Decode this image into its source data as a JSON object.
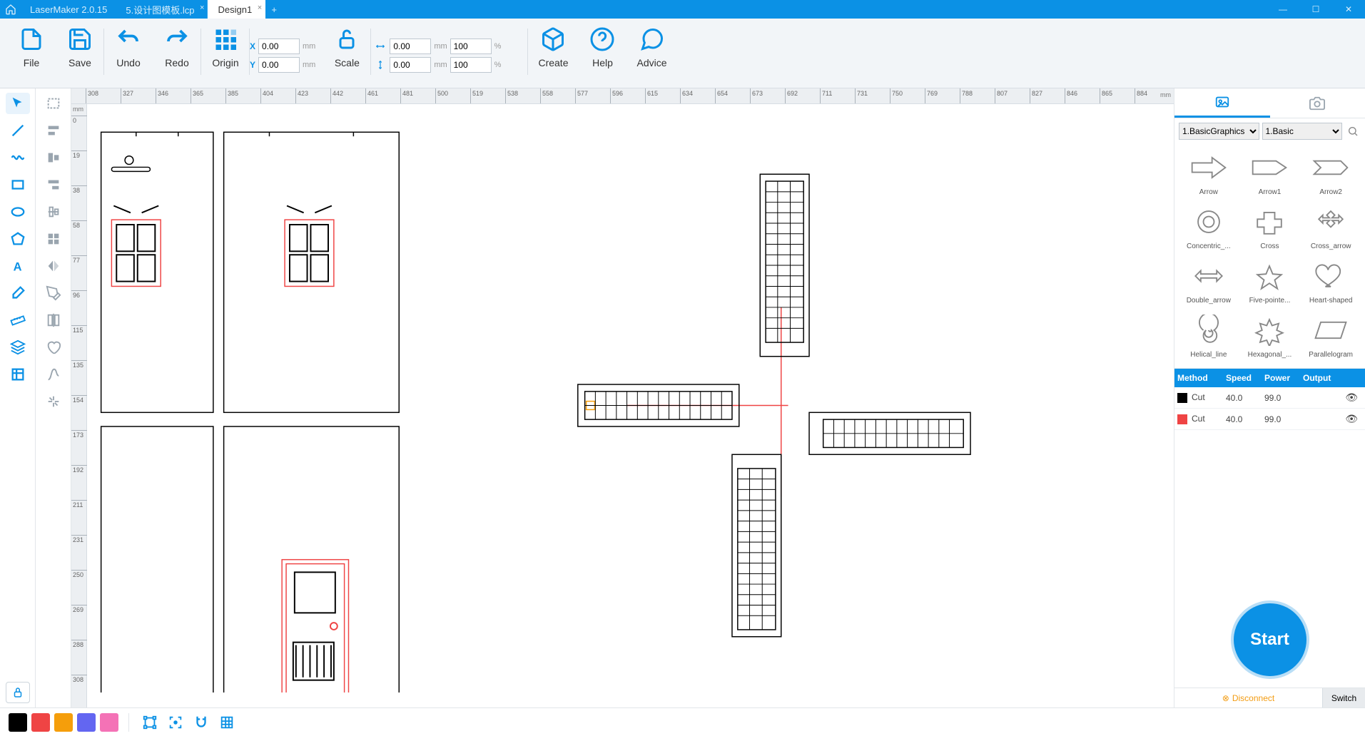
{
  "app": {
    "name": "LaserMaker 2.0.15"
  },
  "tabs": [
    {
      "label": "5.设计图模板.lcp",
      "active": false
    },
    {
      "label": "Design1",
      "active": true
    }
  ],
  "toolbar": {
    "file": "File",
    "save": "Save",
    "undo": "Undo",
    "redo": "Redo",
    "origin": "Origin",
    "scale": "Scale",
    "create": "Create",
    "help": "Help",
    "advice": "Advice",
    "x_label": "X",
    "y_label": "Y",
    "x_val": "0.00",
    "y_val": "0.00",
    "mm": "mm",
    "w_val": "0.00",
    "h_val": "0.00",
    "w_pct": "100",
    "h_pct": "100",
    "pct": "%"
  },
  "ruler": {
    "unit": "mm",
    "h_ticks": [
      308,
      327,
      346,
      365,
      385,
      404,
      423,
      442,
      461,
      481,
      500,
      519,
      538,
      558,
      577,
      596,
      615,
      634,
      654,
      673,
      692,
      711,
      731,
      750,
      769,
      788,
      807,
      827,
      846,
      865,
      884
    ],
    "v_ticks": [
      0,
      19,
      38,
      58,
      77,
      96,
      115,
      135,
      154,
      173,
      192,
      211,
      231,
      250,
      269,
      288,
      308
    ]
  },
  "library": {
    "cat1": "1.BasicGraphics",
    "cat2": "1.Basic",
    "shapes": [
      "Arrow",
      "Arrow1",
      "Arrow2",
      "Concentric_...",
      "Cross",
      "Cross_arrow",
      "Double_arrow",
      "Five-pointe...",
      "Heart-shaped",
      "Helical_line",
      "Hexagonal_...",
      "Parallelogram"
    ]
  },
  "layers": {
    "headers": {
      "method": "Method",
      "speed": "Speed",
      "power": "Power",
      "output": "Output"
    },
    "rows": [
      {
        "color": "#000000",
        "method": "Cut",
        "speed": "40.0",
        "power": "99.0"
      },
      {
        "color": "#ef4444",
        "method": "Cut",
        "speed": "40.0",
        "power": "99.0"
      }
    ]
  },
  "start": "Start",
  "footer": {
    "disconnect": "Disconnect",
    "switch": "Switch"
  },
  "palette": [
    "#000000",
    "#ef4444",
    "#f59e0b",
    "#6366f1",
    "#f472b6"
  ]
}
